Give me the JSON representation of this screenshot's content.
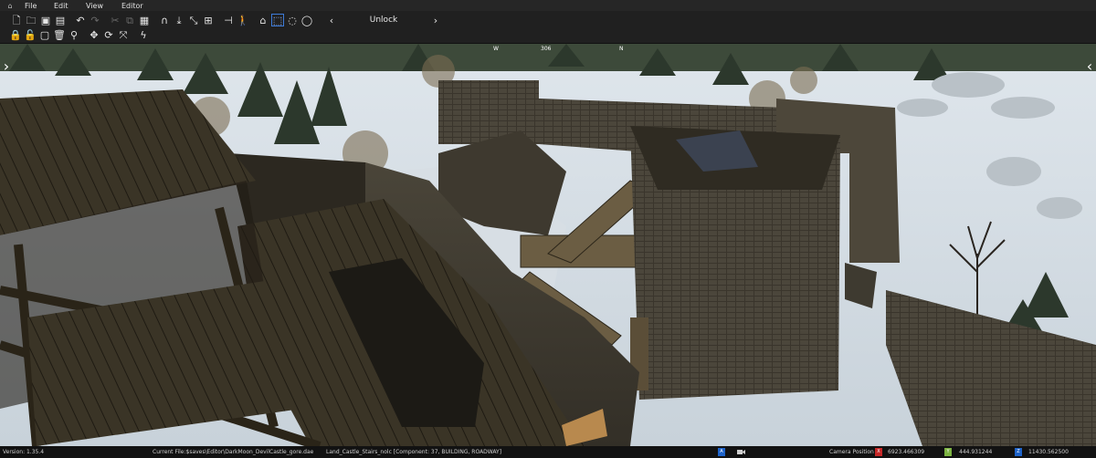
{
  "menu": {
    "items": [
      "File",
      "Edit",
      "View",
      "Editor"
    ]
  },
  "toolbar": {
    "row1_icons": [
      "new-icon",
      "open-icon",
      "save-icon",
      "save-as-icon",
      "undo-icon",
      "redo-icon",
      "cut-icon",
      "copy-icon",
      "paste-icon",
      "magnet-icon",
      "import-icon",
      "collapse-icon",
      "grid-icon",
      "ruler-icon",
      "walk-icon",
      "home-icon",
      "rect-select-icon",
      "circle-select-icon",
      "lasso-select-icon"
    ],
    "row2_icons": [
      "lock-icon",
      "unlock-icon",
      "lock-all-icon",
      "delete-icon",
      "key-icon",
      "move-icon",
      "rotate-icon",
      "scale-icon",
      "lightning-icon"
    ],
    "unlock_label": "Unlock",
    "prev_label": "‹",
    "next_label": "›"
  },
  "viewport": {
    "compass": {
      "w": "W",
      "deg": "306",
      "n": "N"
    },
    "left_arrow": "›",
    "right_arrow": "‹"
  },
  "status": {
    "version": "Version:   1.35.4",
    "current_file": "Current File:$saves\\Editor\\DarkMoon_DevilCastle_gore.dae",
    "selection": "Land_Castle_Stairs_nolc [Component: 37, BUILDING, ROADWAY]",
    "camera_label": "Camera Position",
    "x_axis": "X",
    "x_value": "6923.466309",
    "y_axis": "Y",
    "y_value": "444.931244",
    "z_axis": "Z",
    "z_value": "11430.562500",
    "colors": {
      "x": "#c62828",
      "y": "#7cb342",
      "z": "#1e63c9",
      "selected_tool": "#3d7bd9"
    }
  }
}
